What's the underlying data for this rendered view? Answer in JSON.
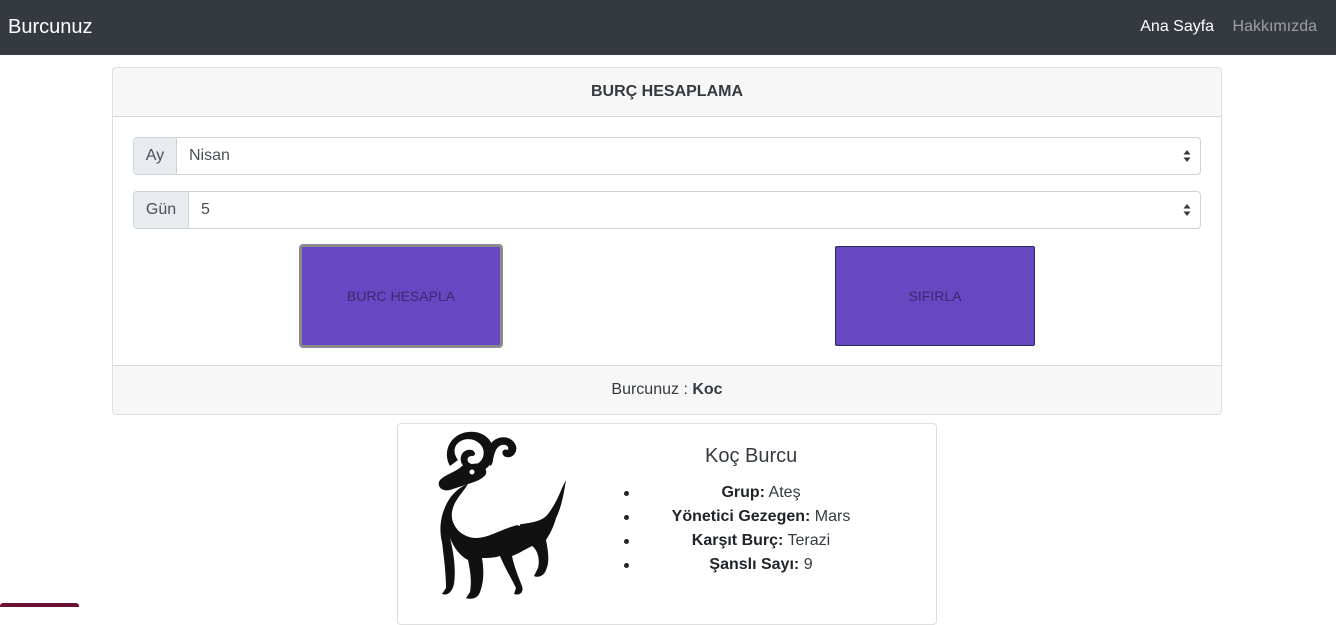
{
  "navbar": {
    "brand": "Burcunuz",
    "links": [
      "Ana Sayfa",
      "Hakkımızda"
    ]
  },
  "calculator": {
    "title": "BURÇ HESAPLAMA",
    "month": {
      "label": "Ay",
      "value": "Nisan"
    },
    "day": {
      "label": "Gün",
      "value": "5"
    },
    "calc_button": "BURC HESAPLA",
    "reset_button": "SIFIRLA",
    "result_label": "Burcunuz :",
    "result_value": "Koc"
  },
  "sign": {
    "title": "Koç Burcu",
    "image_icon": "aries-ram-icon",
    "details": [
      {
        "key": "Grup:",
        "value": "Ateş"
      },
      {
        "key": "Yönetici Gezegen:",
        "value": "Mars"
      },
      {
        "key": "Karşıt Burç:",
        "value": "Terazi"
      },
      {
        "key": "Şanslı Sayı:",
        "value": "9"
      }
    ]
  },
  "colors": {
    "navbar": "#343a40",
    "button": "#6847c2"
  }
}
